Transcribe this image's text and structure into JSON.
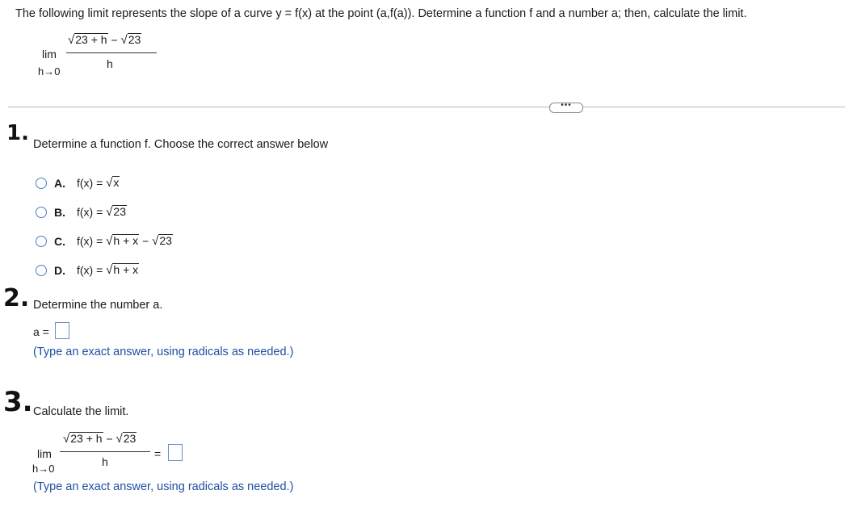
{
  "intro": "The following limit represents the slope of a curve y = f(x) at the point (a,f(a)). Determine a function f and a number a; then, calculate the limit.",
  "limit_expr": {
    "lim": "lim",
    "sub": "h→0",
    "num_a": "23 + h",
    "minus": "−",
    "num_b": "23",
    "den": "h"
  },
  "more_button": "•••",
  "part1": {
    "marker": "1.",
    "question": "Determine a function f. Choose the correct answer below",
    "options": [
      {
        "letter": "A.",
        "prefix": "f(x) = ",
        "rad1": "x",
        "rest": "",
        "rad2": ""
      },
      {
        "letter": "B.",
        "prefix": "f(x) = ",
        "rad1": "23",
        "rest": "",
        "rad2": ""
      },
      {
        "letter": "C.",
        "prefix": "f(x) = ",
        "rad1": "h + x",
        "rest": " − ",
        "rad2": "23"
      },
      {
        "letter": "D.",
        "prefix": "f(x) = ",
        "rad1": "h + x",
        "rest": "",
        "rad2": ""
      }
    ]
  },
  "part2": {
    "marker": "2.",
    "question": "Determine the number a.",
    "label": "a =",
    "hint": "(Type an exact answer, using radicals as needed.)"
  },
  "part3": {
    "marker": "3.",
    "question": "Calculate the limit.",
    "equals": "=",
    "hint": "(Type an exact answer, using radicals as needed.)"
  }
}
